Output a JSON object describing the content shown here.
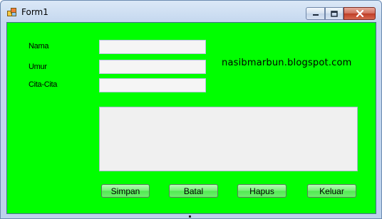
{
  "window": {
    "title": "Form1",
    "controls": {
      "minimize": "minimize-icon",
      "maximize": "maximize-icon",
      "close": "close-icon"
    }
  },
  "colors": {
    "client_background": "#00ff00",
    "close_button": "#c9452e"
  },
  "form": {
    "labels": {
      "nama": "Nama",
      "umur": "Umur",
      "cita_cita": "Cita-Cita"
    },
    "values": {
      "nama": "",
      "umur": "",
      "cita_cita": ""
    },
    "memo": "",
    "watermark": "nasibmarbun.blogspot.com"
  },
  "buttons": {
    "simpan": "Simpan",
    "batal": "Batal",
    "hapus": "Hapus",
    "keluar": "Keluar"
  }
}
